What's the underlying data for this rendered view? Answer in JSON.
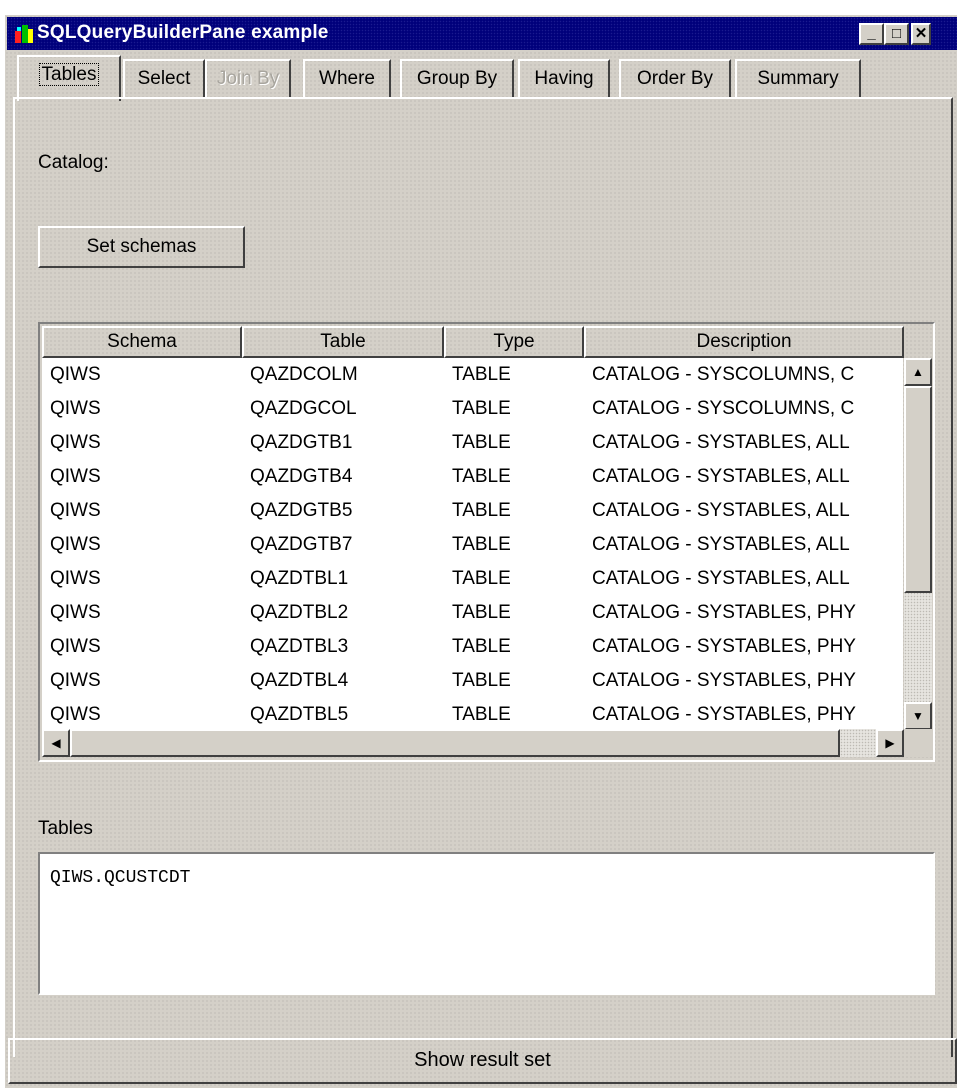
{
  "window": {
    "title": "SQLQueryBuilderPane example",
    "controls": {
      "minimize": "_",
      "maximize": "□",
      "close": "✕"
    }
  },
  "tabs": [
    {
      "label": "Tables",
      "state": "active"
    },
    {
      "label": "Select",
      "state": "enabled"
    },
    {
      "label": "Join By",
      "state": "disabled"
    },
    {
      "label": "Where",
      "state": "enabled"
    },
    {
      "label": "Group By",
      "state": "enabled"
    },
    {
      "label": "Having",
      "state": "enabled"
    },
    {
      "label": "Order By",
      "state": "enabled"
    },
    {
      "label": "Summary",
      "state": "enabled"
    }
  ],
  "catalog": {
    "label": "Catalog:"
  },
  "set_schemas": {
    "label": "Set schemas"
  },
  "table_grid": {
    "columns": [
      "Schema",
      "Table",
      "Type",
      "Description"
    ],
    "rows": [
      [
        "QIWS",
        "QAZDCOLM",
        "TABLE",
        "CATALOG - SYSCOLUMNS, C"
      ],
      [
        "QIWS",
        "QAZDGCOL",
        "TABLE",
        "CATALOG - SYSCOLUMNS, C"
      ],
      [
        "QIWS",
        "QAZDGTB1",
        "TABLE",
        "CATALOG - SYSTABLES, ALL"
      ],
      [
        "QIWS",
        "QAZDGTB4",
        "TABLE",
        "CATALOG - SYSTABLES, ALL"
      ],
      [
        "QIWS",
        "QAZDGTB5",
        "TABLE",
        "CATALOG - SYSTABLES, ALL"
      ],
      [
        "QIWS",
        "QAZDGTB7",
        "TABLE",
        "CATALOG - SYSTABLES, ALL"
      ],
      [
        "QIWS",
        "QAZDTBL1",
        "TABLE",
        "CATALOG - SYSTABLES, ALL"
      ],
      [
        "QIWS",
        "QAZDTBL2",
        "TABLE",
        "CATALOG - SYSTABLES, PHY"
      ],
      [
        "QIWS",
        "QAZDTBL3",
        "TABLE",
        "CATALOG - SYSTABLES, PHY"
      ],
      [
        "QIWS",
        "QAZDTBL4",
        "TABLE",
        "CATALOG - SYSTABLES, PHY"
      ],
      [
        "QIWS",
        "QAZDTBL5",
        "TABLE",
        "CATALOG - SYSTABLES, PHY"
      ]
    ],
    "scroll_icons": {
      "up": "scroll-up-arrow",
      "down": "scroll-down-arrow",
      "left": "scroll-left-arrow",
      "right": "scroll-right-arrow"
    }
  },
  "tables_section": {
    "label": "Tables",
    "value": "QIWS.QCUSTCDT"
  },
  "result_button": {
    "label": "Show result set"
  }
}
